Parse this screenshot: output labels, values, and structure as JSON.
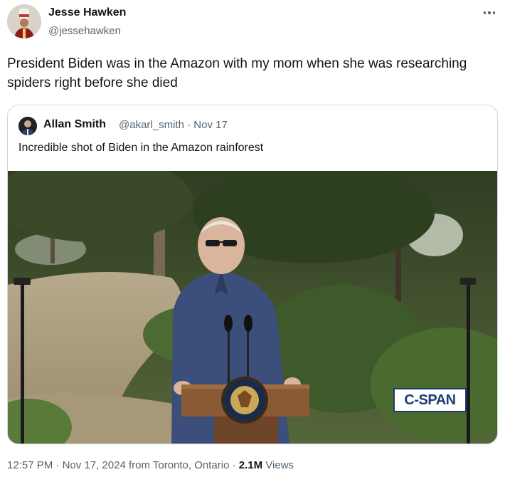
{
  "author": {
    "name": "Jesse Hawken",
    "handle": "@jessehawken"
  },
  "more_icon": "more-horizontal-icon",
  "tweet_text": "President Biden was in the Amazon with my mom when she was researching spiders right before she died",
  "quoted": {
    "name": "Allan Smith",
    "handle": "@akarl_smith",
    "separator": "·",
    "date": "Nov 17",
    "text": "Incredible shot of Biden in the Amazon rainforest",
    "watermark": "C-SPAN"
  },
  "footer": {
    "time": "12:57 PM",
    "sep1": "·",
    "date": "Nov 17, 2024",
    "location": "from Toronto, Ontario",
    "sep2": "·",
    "views_count": "2.1M",
    "views_label": "Views"
  },
  "colors": {
    "text": "#0f1419",
    "secondary": "#536471",
    "border": "#cfd9de",
    "cspan": "#1d3e75"
  }
}
